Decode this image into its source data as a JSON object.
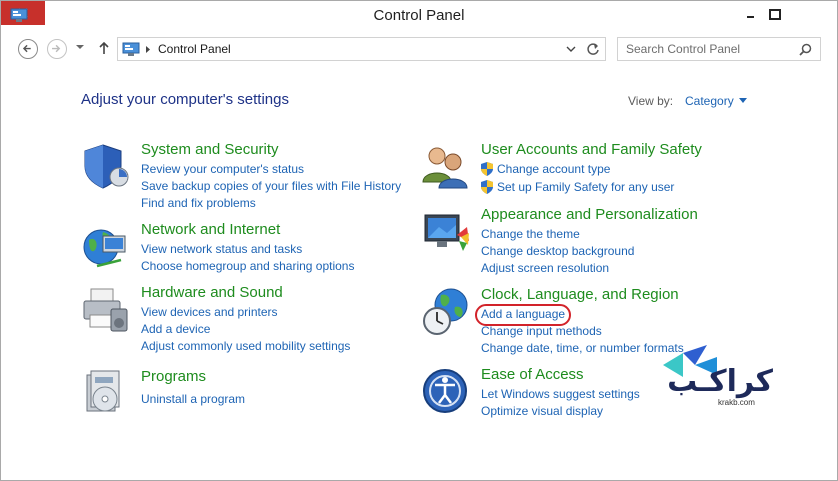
{
  "window": {
    "title": "Control Panel"
  },
  "address_bar": {
    "path": "Control Panel"
  },
  "search": {
    "placeholder": "Search Control Panel"
  },
  "header": {
    "title": "Adjust your computer's settings",
    "view_by_label": "View by:",
    "view_by_value": "Category"
  },
  "categories": [
    {
      "title": "System and Security",
      "links": [
        "Review your computer's status",
        "Save backup copies of your files with File History",
        "Find and fix problems"
      ],
      "icon": "shield-icon"
    },
    {
      "title": "Network and Internet",
      "links": [
        "View network status and tasks",
        "Choose homegroup and sharing options"
      ],
      "icon": "network-globe-icon"
    },
    {
      "title": "Hardware and Sound",
      "links": [
        "View devices and printers",
        "Add a device",
        "Adjust commonly used mobility settings"
      ],
      "icon": "printer-icon"
    },
    {
      "title": "Programs",
      "links": [
        "Uninstall a program"
      ],
      "icon": "programs-icon"
    },
    {
      "title": "User Accounts and Family Safety",
      "links": [
        "Change account type",
        "Set up Family Safety for any user"
      ],
      "icon": "users-icon"
    },
    {
      "title": "Appearance and Personalization",
      "links": [
        "Change the theme",
        "Change desktop background",
        "Adjust screen resolution"
      ],
      "icon": "monitor-palette-icon"
    },
    {
      "title": "Clock, Language, and Region",
      "links": [
        "Add a language",
        "Change input methods",
        "Change date, time, or number formats"
      ],
      "icon": "clock-globe-icon"
    },
    {
      "title": "Ease of Access",
      "links": [
        "Let Windows suggest settings",
        "Optimize visual display"
      ],
      "icon": "ease-of-access-icon"
    }
  ],
  "watermark": {
    "brand": "کراکـب",
    "url": "krakb.com"
  },
  "colors": {
    "category_title": "#1e8c1e",
    "link": "#1e64b4",
    "page_title": "#1e3287",
    "highlight": "#d2232a"
  }
}
